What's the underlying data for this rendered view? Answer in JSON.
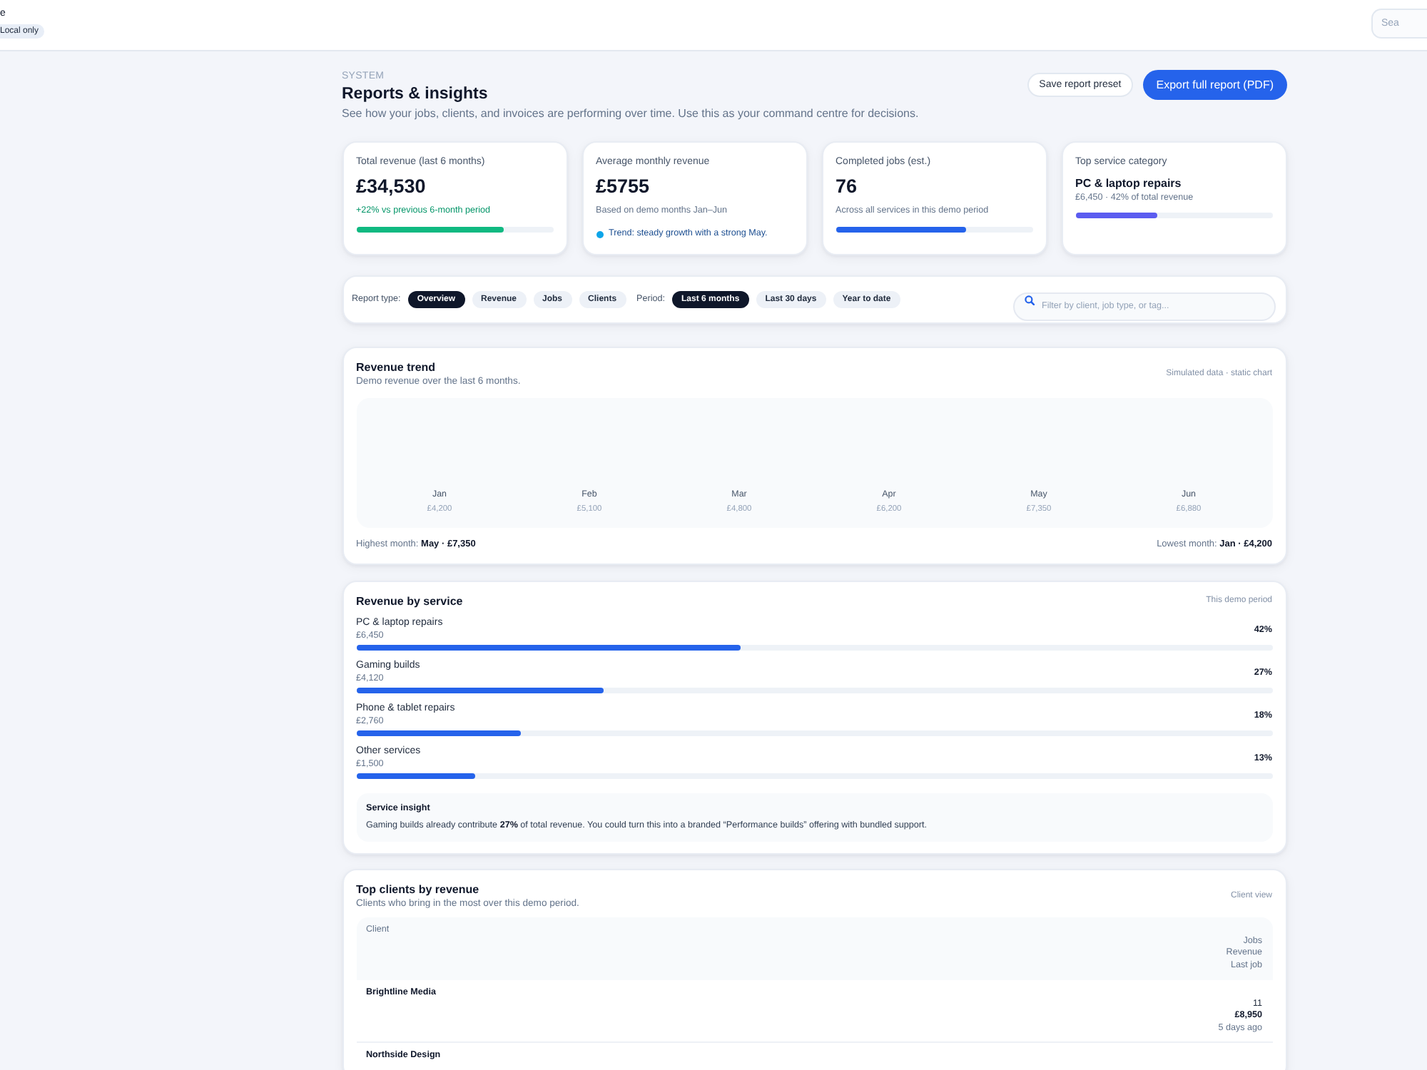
{
  "top_bar": {
    "title": "e",
    "badge": "Local only",
    "search": {
      "placeholder": "Sea"
    }
  },
  "header": {
    "eyebrow": "SYSTEM",
    "title": "Reports & insights",
    "description": "See how your jobs, clients, and invoices are performing over time. Use this as your command centre for decisions.",
    "actions": [
      {
        "label": "Save report preset",
        "kind": "secondary"
      },
      {
        "label": "Export full report (PDF)",
        "kind": "primary"
      }
    ]
  },
  "kpis": [
    {
      "kind": "metric",
      "label": "Total revenue (last 6 months)",
      "value": "£34,530",
      "note": "+22% vs previous 6-month period",
      "positive": true,
      "level": 0.75,
      "color": "#10b981"
    },
    {
      "kind": "metric",
      "label": "Average monthly revenue",
      "value": "£5755",
      "note": "Based on demo months Jan–Jun",
      "positive": false,
      "trend": {
        "text": "Trend: steady growth with a strong May.",
        "color": "#0ea5e9"
      }
    },
    {
      "kind": "metric",
      "label": "Completed jobs (est.)",
      "value": "76",
      "note": "Across all services in this demo period",
      "positive": false,
      "level": 0.66,
      "color": "#2563eb"
    },
    {
      "kind": "category",
      "label": "Top service category",
      "value": "PC & laptop repairs",
      "note": "£6,450 · 42% of total revenue",
      "positive": false,
      "level": 0.42,
      "color": "#5b5cf0"
    }
  ],
  "filters": {
    "groups": [
      {
        "label": "Report type:",
        "options": [
          {
            "label": "Overview",
            "selected": true
          },
          {
            "label": "Revenue",
            "selected": false
          },
          {
            "label": "Jobs",
            "selected": false
          },
          {
            "label": "Clients",
            "selected": false
          }
        ]
      },
      {
        "label": "Period:",
        "options": [
          {
            "label": "Last 6 months",
            "selected": true
          },
          {
            "label": "Last 30 days",
            "selected": false
          },
          {
            "label": "Year to date",
            "selected": false
          }
        ]
      }
    ],
    "search": {
      "placeholder": "Filter by client, job type, or tag..."
    }
  },
  "revenue_trend": {
    "title": "Revenue trend",
    "subtitle": "Demo revenue over the last 6 months.",
    "meta": "Simulated data · static chart",
    "months": [
      {
        "month": "Jan",
        "amount": "£4,200"
      },
      {
        "month": "Feb",
        "amount": "£5,100"
      },
      {
        "month": "Mar",
        "amount": "£4,800"
      },
      {
        "month": "Apr",
        "amount": "£6,200"
      },
      {
        "month": "May",
        "amount": "£7,350"
      },
      {
        "month": "Jun",
        "amount": "£6,880"
      }
    ],
    "highest": "Highest month: **May · £7,350**",
    "lowest": "Lowest month: **Jan · £4,200**"
  },
  "revenue_by_service": {
    "title": "Revenue by service",
    "meta": "This demo period",
    "services": [
      {
        "name": "PC & laptop repairs",
        "amount": "£6,450",
        "share": "42%",
        "level": 0.42
      },
      {
        "name": "Gaming builds",
        "amount": "£4,120",
        "share": "27%",
        "level": 0.27
      },
      {
        "name": "Phone & tablet repairs",
        "amount": "£2,760",
        "share": "18%",
        "level": 0.18
      },
      {
        "name": "Other services",
        "amount": "£1,500",
        "share": "13%",
        "level": 0.13
      }
    ],
    "insight": {
      "title": "Service insight",
      "text": "Gaming builds already contribute **27%** of total revenue. You could turn this into a branded “Performance builds” offering with bundled support."
    }
  },
  "top_clients": {
    "title": "Top clients by revenue",
    "subtitle": "Clients who bring in the most over this demo period.",
    "meta": "Client view",
    "columns": [
      "Client",
      "Jobs",
      "Revenue",
      "Last job"
    ],
    "rows": [
      {
        "client": "Brightline Media",
        "jobs": "11",
        "revenue": "£8,950",
        "last_job": "5 days ago"
      },
      {
        "client": "Northside Design"
      }
    ]
  }
}
